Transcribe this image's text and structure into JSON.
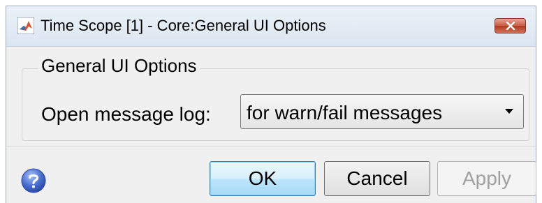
{
  "window": {
    "title": "Time Scope [1] - Core:General UI Options",
    "close_icon": "close-icon"
  },
  "group": {
    "legend": "General UI Options"
  },
  "message_log": {
    "label": "Open message log:",
    "selected": "for warn/fail messages"
  },
  "buttons": {
    "ok": "OK",
    "cancel": "Cancel",
    "apply": "Apply"
  },
  "icons": {
    "app": "matlab-icon",
    "help": "help-icon",
    "dropdown": "chevron-down-icon"
  },
  "colors": {
    "close_button": "#c75a42",
    "ok_button": "#bee6fd",
    "help_icon": "#4a6fd0"
  }
}
